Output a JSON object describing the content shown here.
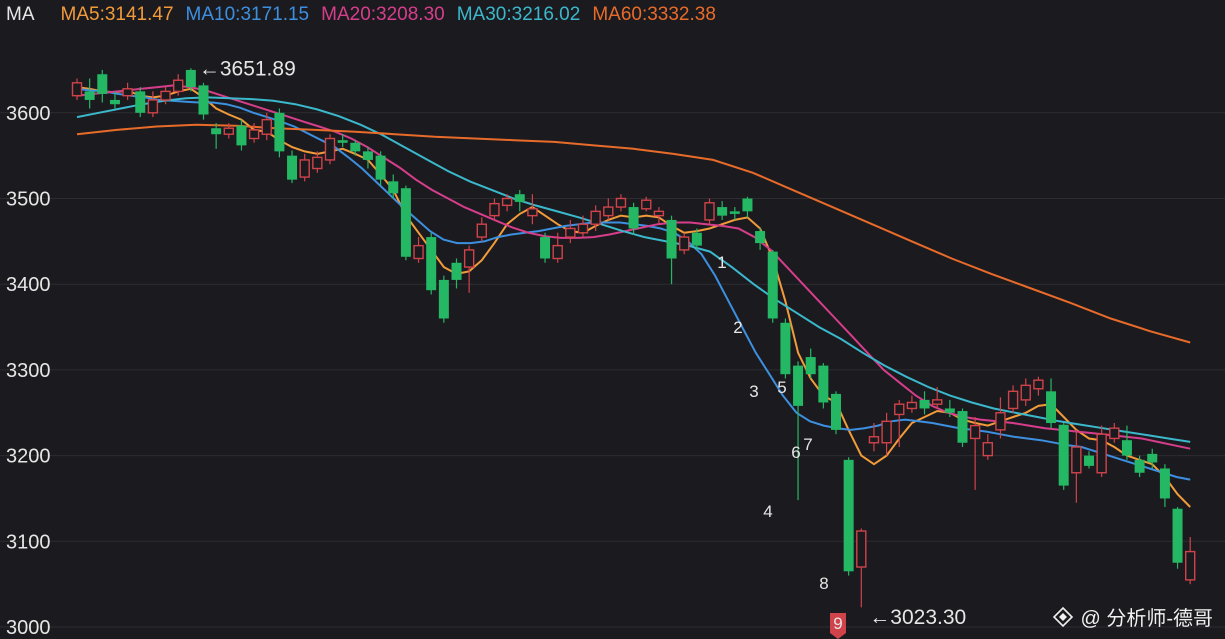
{
  "legend": {
    "title": "MA",
    "items": [
      {
        "label": "MA5:3141.47",
        "color": "#f29b3a"
      },
      {
        "label": "MA10:3171.15",
        "color": "#3d8fe0"
      },
      {
        "label": "MA20:3208.30",
        "color": "#d63e8c"
      },
      {
        "label": "MA30:3216.02",
        "color": "#3bb8cc"
      },
      {
        "label": "MA60:3332.38",
        "color": "#e86b2a"
      }
    ]
  },
  "watermark": {
    "text": "@ 分析师-德哥"
  },
  "chart_data": {
    "type": "candlestick",
    "ylim": [
      3000,
      3680
    ],
    "yticks": [
      3000,
      3100,
      3200,
      3300,
      3400,
      3500,
      3600
    ],
    "grid": true,
    "up_color": "#d0434a",
    "down_color": "#25b864",
    "candles": [
      [
        3620,
        3635,
        3640,
        3615
      ],
      [
        3625,
        3615,
        3640,
        3605
      ],
      [
        3645,
        3622,
        3650,
        3612
      ],
      [
        3615,
        3610,
        3625,
        3605
      ],
      [
        3620,
        3628,
        3635,
        3615
      ],
      [
        3625,
        3600,
        3630,
        3595
      ],
      [
        3600,
        3615,
        3625,
        3595
      ],
      [
        3615,
        3625,
        3630,
        3610
      ],
      [
        3625,
        3638,
        3645,
        3620
      ],
      [
        3650,
        3630,
        3652,
        3625
      ],
      [
        3632,
        3598,
        3635,
        3592
      ],
      [
        3582,
        3575,
        3588,
        3558
      ],
      [
        3575,
        3582,
        3588,
        3570
      ],
      [
        3585,
        3562,
        3592,
        3556
      ],
      [
        3570,
        3580,
        3588,
        3565
      ],
      [
        3575,
        3592,
        3600,
        3568
      ],
      [
        3600,
        3555,
        3605,
        3548
      ],
      [
        3550,
        3522,
        3556,
        3518
      ],
      [
        3525,
        3545,
        3552,
        3520
      ],
      [
        3535,
        3548,
        3555,
        3530
      ],
      [
        3545,
        3570,
        3575,
        3540
      ],
      [
        3568,
        3565,
        3575,
        3560
      ],
      [
        3565,
        3555,
        3568,
        3550
      ],
      [
        3555,
        3545,
        3560,
        3535
      ],
      [
        3550,
        3522,
        3555,
        3515
      ],
      [
        3520,
        3506,
        3528,
        3500
      ],
      [
        3512,
        3432,
        3515,
        3428
      ],
      [
        3430,
        3445,
        3455,
        3425
      ],
      [
        3455,
        3393,
        3460,
        3388
      ],
      [
        3405,
        3360,
        3410,
        3355
      ],
      [
        3425,
        3405,
        3430,
        3395
      ],
      [
        3420,
        3440,
        3445,
        3390
      ],
      [
        3455,
        3470,
        3478,
        3450
      ],
      [
        3480,
        3494,
        3500,
        3475
      ],
      [
        3492,
        3500,
        3505,
        3485
      ],
      [
        3505,
        3496,
        3510,
        3485
      ],
      [
        3480,
        3488,
        3505,
        3470
      ],
      [
        3455,
        3430,
        3460,
        3425
      ],
      [
        3430,
        3445,
        3460,
        3425
      ],
      [
        3455,
        3465,
        3475,
        3448
      ],
      [
        3460,
        3470,
        3480,
        3455
      ],
      [
        3470,
        3485,
        3492,
        3462
      ],
      [
        3480,
        3490,
        3500,
        3475
      ],
      [
        3490,
        3500,
        3505,
        3485
      ],
      [
        3490,
        3465,
        3495,
        3458
      ],
      [
        3488,
        3498,
        3502,
        3485
      ],
      [
        3480,
        3485,
        3490,
        3470
      ],
      [
        3475,
        3430,
        3480,
        3400
      ],
      [
        3440,
        3455,
        3460,
        3435
      ],
      [
        3460,
        3445,
        3465,
        3440
      ],
      [
        3475,
        3495,
        3500,
        3470
      ],
      [
        3490,
        3480,
        3497,
        3475
      ],
      [
        3485,
        3482,
        3490,
        3475
      ],
      [
        3500,
        3485,
        3502,
        3478
      ],
      [
        3462,
        3448,
        3466,
        3440
      ],
      [
        3438,
        3360,
        3440,
        3355
      ],
      [
        3355,
        3295,
        3360,
        3290
      ],
      [
        3305,
        3258,
        3310,
        3148
      ],
      [
        3315,
        3295,
        3325,
        3290
      ],
      [
        3305,
        3262,
        3308,
        3255
      ],
      [
        3272,
        3230,
        3275,
        3225
      ],
      [
        3195,
        3065,
        3198,
        3060
      ],
      [
        3070,
        3112,
        3115,
        3023
      ],
      [
        3215,
        3222,
        3238,
        3205
      ],
      [
        3215,
        3240,
        3250,
        3200
      ],
      [
        3248,
        3260,
        3265,
        3210
      ],
      [
        3255,
        3262,
        3270,
        3250
      ],
      [
        3265,
        3255,
        3275,
        3248
      ],
      [
        3260,
        3265,
        3280,
        3255
      ],
      [
        3255,
        3250,
        3265,
        3245
      ],
      [
        3252,
        3215,
        3255,
        3210
      ],
      [
        3220,
        3235,
        3245,
        3160
      ],
      [
        3200,
        3215,
        3225,
        3195
      ],
      [
        3230,
        3250,
        3268,
        3220
      ],
      [
        3255,
        3275,
        3282,
        3250
      ],
      [
        3265,
        3282,
        3290,
        3258
      ],
      [
        3278,
        3288,
        3292,
        3270
      ],
      [
        3275,
        3238,
        3290,
        3232
      ],
      [
        3236,
        3165,
        3238,
        3160
      ],
      [
        3180,
        3210,
        3230,
        3145
      ],
      [
        3200,
        3188,
        3205,
        3185
      ],
      [
        3180,
        3225,
        3235,
        3175
      ],
      [
        3220,
        3232,
        3238,
        3215
      ],
      [
        3218,
        3200,
        3235,
        3195
      ],
      [
        3195,
        3180,
        3200,
        3175
      ],
      [
        3202,
        3192,
        3208,
        3185
      ],
      [
        3185,
        3150,
        3190,
        3140
      ],
      [
        3138,
        3075,
        3140,
        3068
      ],
      [
        3055,
        3088,
        3105,
        3050
      ]
    ],
    "series": [
      {
        "name": "MA5",
        "color": "#f29b3a",
        "values": [
          3630,
          3628,
          3625,
          3624,
          3626,
          3620,
          3618,
          3620,
          3625,
          3628,
          3618,
          3605,
          3598,
          3592,
          3580,
          3578,
          3568,
          3560,
          3555,
          3552,
          3555,
          3558,
          3552,
          3545,
          3528,
          3510,
          3480,
          3460,
          3440,
          3420,
          3412,
          3415,
          3428,
          3448,
          3470,
          3482,
          3490,
          3480,
          3470,
          3462,
          3460,
          3468,
          3475,
          3480,
          3478,
          3480,
          3478,
          3468,
          3460,
          3462,
          3465,
          3470,
          3475,
          3478,
          3465,
          3430,
          3380,
          3320,
          3290,
          3270,
          3262,
          3230,
          3200,
          3190,
          3200,
          3220,
          3238,
          3245,
          3252,
          3250,
          3242,
          3238,
          3235,
          3240,
          3245,
          3250,
          3258,
          3260,
          3245,
          3230,
          3220,
          3218,
          3210,
          3200,
          3195,
          3190,
          3175,
          3155,
          3140
        ]
      },
      {
        "name": "MA10",
        "color": "#3d8fe0",
        "values": [
          3628,
          3626,
          3625,
          3622,
          3620,
          3618,
          3615,
          3614,
          3613,
          3612,
          3612,
          3610,
          3606,
          3600,
          3595,
          3590,
          3584,
          3576,
          3568,
          3560,
          3548,
          3535,
          3520,
          3505,
          3490,
          3476,
          3462,
          3452,
          3448,
          3448,
          3450,
          3455,
          3458,
          3460,
          3462,
          3465,
          3468,
          3470,
          3472,
          3472,
          3472,
          3470,
          3468,
          3465,
          3460,
          3450,
          3435,
          3410,
          3380,
          3350,
          3320,
          3295,
          3270,
          3250,
          3240,
          3235,
          3232,
          3230,
          3232,
          3235,
          3240,
          3242,
          3240,
          3238,
          3235,
          3232,
          3230,
          3228,
          3225,
          3222,
          3220,
          3218,
          3215,
          3212,
          3210,
          3205,
          3200,
          3195,
          3190,
          3185,
          3180,
          3175,
          3172
        ]
      },
      {
        "name": "MA20",
        "color": "#d63e8c",
        "values": [
          3620,
          3622,
          3624,
          3626,
          3628,
          3630,
          3632,
          3630,
          3626,
          3620,
          3614,
          3608,
          3602,
          3596,
          3590,
          3584,
          3578,
          3570,
          3560,
          3548,
          3536,
          3522,
          3510,
          3500,
          3490,
          3482,
          3474,
          3466,
          3460,
          3456,
          3454,
          3454,
          3455,
          3458,
          3462,
          3466,
          3470,
          3472,
          3472,
          3470,
          3468,
          3465,
          3455,
          3440,
          3420,
          3400,
          3380,
          3360,
          3340,
          3320,
          3300,
          3285,
          3270,
          3258,
          3250,
          3245,
          3242,
          3240,
          3238,
          3235,
          3232,
          3230,
          3228,
          3226,
          3224,
          3222,
          3220,
          3216,
          3212,
          3208
        ]
      },
      {
        "name": "MA30",
        "color": "#3bb8cc",
        "values": [
          3595,
          3600,
          3605,
          3610,
          3614,
          3617,
          3618,
          3617,
          3616,
          3614,
          3610,
          3604,
          3596,
          3586,
          3574,
          3560,
          3546,
          3532,
          3520,
          3510,
          3500,
          3492,
          3485,
          3478,
          3470,
          3462,
          3455,
          3450,
          3445,
          3438,
          3420,
          3400,
          3382,
          3366,
          3350,
          3336,
          3320,
          3305,
          3292,
          3280,
          3270,
          3262,
          3255,
          3250,
          3245,
          3240,
          3236,
          3232,
          3228,
          3224,
          3220,
          3216
        ]
      },
      {
        "name": "MA60",
        "color": "#e86b2a",
        "values": [
          3575,
          3580,
          3584,
          3586,
          3585,
          3582,
          3580,
          3578,
          3575,
          3572,
          3570,
          3568,
          3566,
          3562,
          3558,
          3552,
          3545,
          3530,
          3510,
          3490,
          3470,
          3450,
          3430,
          3412,
          3395,
          3378,
          3360,
          3345,
          3332
        ]
      }
    ],
    "annotations": [
      {
        "text": "←3651.89"
      },
      {
        "text": "←3023.30"
      }
    ],
    "sequence_labels": [
      "1",
      "2",
      "3",
      "4",
      "5",
      "6",
      "7",
      "8",
      "9"
    ]
  }
}
